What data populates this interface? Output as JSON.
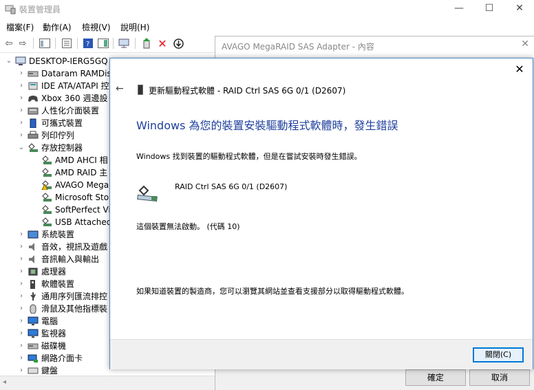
{
  "dm": {
    "title": "裝置管理員",
    "menu": [
      "檔案(F)",
      "動作(A)",
      "檢視(V)",
      "說明(H)"
    ],
    "tree": [
      {
        "label": "DESKTOP-IERG5GQ",
        "icon": "computer-icon",
        "twist": "open",
        "indent": 0
      },
      {
        "label": "Dataram RAMDis",
        "icon": "disk-icon",
        "twist": "closed",
        "indent": 1
      },
      {
        "label": "IDE ATA/ATAPI 控",
        "icon": "ide-controller-icon",
        "twist": "closed",
        "indent": 1
      },
      {
        "label": "Xbox 360 週邊設",
        "icon": "gamepad-icon",
        "twist": "closed",
        "indent": 1
      },
      {
        "label": "人性化介面裝置",
        "icon": "hid-icon",
        "twist": "closed",
        "indent": 1
      },
      {
        "label": "可攜式裝置",
        "icon": "portable-device-icon",
        "twist": "closed",
        "indent": 1
      },
      {
        "label": "列印佇列",
        "icon": "printer-icon",
        "twist": "closed",
        "indent": 1
      },
      {
        "label": "存放控制器",
        "icon": "storage-controller-icon",
        "twist": "open",
        "indent": 1
      },
      {
        "label": "AMD AHCI 相",
        "icon": "storage-controller-icon",
        "twist": "none",
        "indent": 2
      },
      {
        "label": "AMD RAID 主",
        "icon": "storage-controller-icon",
        "twist": "none",
        "indent": 2
      },
      {
        "label": "AVAGO Mega",
        "icon": "storage-controller-warning-icon",
        "twist": "none",
        "indent": 2
      },
      {
        "label": "Microsoft Sto",
        "icon": "storage-controller-icon",
        "twist": "none",
        "indent": 2
      },
      {
        "label": "SoftPerfect Vi",
        "icon": "storage-controller-icon",
        "twist": "none",
        "indent": 2
      },
      {
        "label": "USB Attached",
        "icon": "storage-controller-icon",
        "twist": "none",
        "indent": 2
      },
      {
        "label": "系統裝置",
        "icon": "system-device-icon",
        "twist": "closed",
        "indent": 1
      },
      {
        "label": "音效，視訊及遊戲",
        "icon": "speaker-icon",
        "twist": "closed",
        "indent": 1
      },
      {
        "label": "音訊輸入與輸出",
        "icon": "speaker-icon",
        "twist": "closed",
        "indent": 1
      },
      {
        "label": "處理器",
        "icon": "processor-icon",
        "twist": "closed",
        "indent": 1
      },
      {
        "label": "軟體裝置",
        "icon": "software-device-icon",
        "twist": "closed",
        "indent": 1
      },
      {
        "label": "通用序列匯流排控",
        "icon": "usb-icon",
        "twist": "closed",
        "indent": 1
      },
      {
        "label": "滑鼠及其他指標裝",
        "icon": "mouse-icon",
        "twist": "closed",
        "indent": 1
      },
      {
        "label": "電腦",
        "icon": "monitor-icon",
        "twist": "closed",
        "indent": 1
      },
      {
        "label": "監視器",
        "icon": "monitor-icon",
        "twist": "closed",
        "indent": 1
      },
      {
        "label": "磁碟機",
        "icon": "disk-icon",
        "twist": "closed",
        "indent": 1
      },
      {
        "label": "網路介面卡",
        "icon": "network-adapter-icon",
        "twist": "closed",
        "indent": 1
      },
      {
        "label": "鍵盤",
        "icon": "keyboard-icon",
        "twist": "closed",
        "indent": 1
      }
    ]
  },
  "prop": {
    "title": "AVAGO MegaRAID SAS Adapter - 內容",
    "ok_label": "確定",
    "cancel_label": "取消"
  },
  "wizard": {
    "header_title": "更新驅動程式軟體 - RAID Ctrl SAS 6G 0/1 (D2607)",
    "heading": "Windows 為您的裝置安裝驅動程式軟體時，發生錯誤",
    "description": "Windows 找到裝置的驅動程式軟體，但是在嘗試安裝時發生錯誤。",
    "device_name": "RAID Ctrl SAS 6G 0/1 (D2607)",
    "error_code": "這個裝置無法啟動。 (代碼 10)",
    "help_text": "如果知道裝置的製造商，您可以瀏覽其網站並查看支援部分以取得驅動程式軟體。",
    "close_button": "關閉(C)"
  },
  "colors": {
    "heading": "#1e3f9c",
    "accent": "#0078d7",
    "error": "#e81123"
  }
}
